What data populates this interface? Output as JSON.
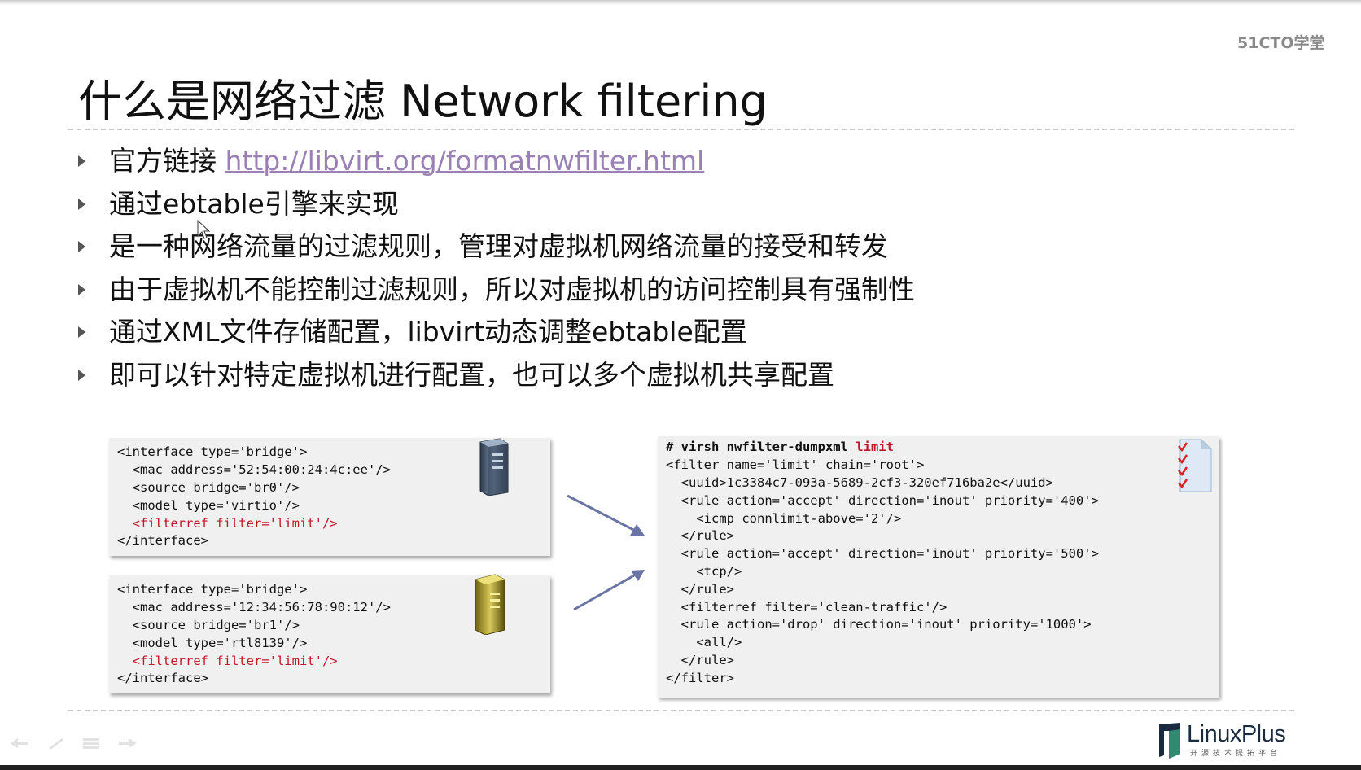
{
  "brand": "51CTO学堂",
  "title": "什么是网络过滤 Network filtering",
  "bullets": {
    "b1_prefix": "官方链接 ",
    "b1_link": "http://libvirt.org/formatnwfilter.html",
    "b2": "通过ebtable引擎来实现",
    "b3": "是一种网络流量的过滤规则，管理对虚拟机网络流量的接受和转发",
    "b4": "由于虚拟机不能控制过滤规则，所以对虚拟机的访问控制具有强制性",
    "b5": "通过XML文件存储配置，libvirt动态调整ebtable配置",
    "b6": "即可以针对特定虚拟机进行配置，也可以多个虚拟机共享配置"
  },
  "interface1": {
    "l1": "<interface type='bridge'>",
    "l2": "  <mac address='52:54:00:24:4c:ee'/>",
    "l3": "  <source bridge='br0'/>",
    "l4": "  <model type='virtio'/>",
    "l5": "  <filterref filter='limit'/>",
    "l6": "</interface>"
  },
  "interface2": {
    "l1": "<interface type='bridge'>",
    "l2": "  <mac address='12:34:56:78:90:12'/>",
    "l3": "  <source bridge='br1'/>",
    "l4": "  <model type='rtl8139'/>",
    "l5": "  <filterref filter='limit'/>",
    "l6": "</interface>"
  },
  "filter_xml": {
    "cmd": "# virsh nwfilter-dumpxml ",
    "cmd_arg": "limit",
    "l2": "<filter name='limit' chain='root'>",
    "l3": "  <uuid>1c3384c7-093a-5689-2cf3-320ef716ba2e</uuid>",
    "l4": "  <rule action='accept' direction='inout' priority='400'>",
    "l5": "    <icmp connlimit-above='2'/>",
    "l6": "  </rule>",
    "l7": "  <rule action='accept' direction='inout' priority='500'>",
    "l8": "    <tcp/>",
    "l9": "  </rule>",
    "l10": "  <filterref filter='clean-traffic'/>",
    "l11": "  <rule action='drop' direction='inout' priority='1000'>",
    "l12": "    <all/>",
    "l13": "  </rule>",
    "l14": "</filter>"
  },
  "logo": {
    "text": "LinuxPlus",
    "sub": "开源技术提拓平台"
  },
  "colors": {
    "link": "#9a80b4",
    "code_red": "#c0182a",
    "code_bg": "#f0f0f0"
  },
  "icons": [
    "server-tower-icon",
    "server-tower-gold-icon",
    "arrow-right-down-icon",
    "arrow-right-up-icon",
    "checklist-document-icon",
    "linuxplus-logo-icon",
    "previous-slide-icon",
    "pen-icon",
    "menu-icon",
    "next-slide-icon"
  ]
}
